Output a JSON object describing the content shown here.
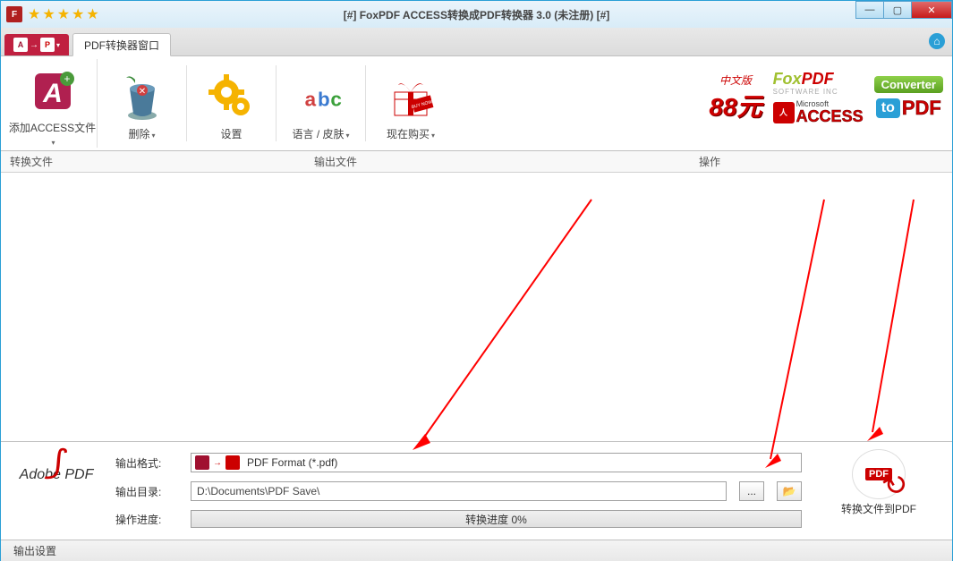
{
  "title": "[#] FoxPDF ACCESS转换成PDF转换器 3.0 (未注册) [#]",
  "tab_label": "PDF转换器窗口",
  "ribbon": {
    "add": "添加ACCESS文件",
    "delete": "删除",
    "settings": "设置",
    "lang": "语言 / 皮肤",
    "buy": "现在购买"
  },
  "promo": {
    "cn": "中文版",
    "price": "88元"
  },
  "foxpdf": {
    "fox": "Fox",
    "pdf": "PDF",
    "sub": "SOFTWARE INC"
  },
  "access": {
    "ms": "Microsoft",
    "ac": "ACCESS"
  },
  "converter_badge": "Converter",
  "topdf": {
    "to": "to",
    "pdf": "PDF"
  },
  "columns": {
    "c1": "转换文件",
    "c2": "输出文件",
    "c3": "操作"
  },
  "adobe": "Adobe PDF",
  "form": {
    "format_label": "输出格式:",
    "format_value": "PDF Format (*.pdf)",
    "dir_label": "输出目录:",
    "dir_value": "D:\\Documents\\PDF Save\\",
    "browse_dots": "...",
    "progress_label": "操作进度:",
    "progress_text": "转换进度 0%"
  },
  "convert_label": "转换文件到PDF",
  "status_left": "输出设置"
}
